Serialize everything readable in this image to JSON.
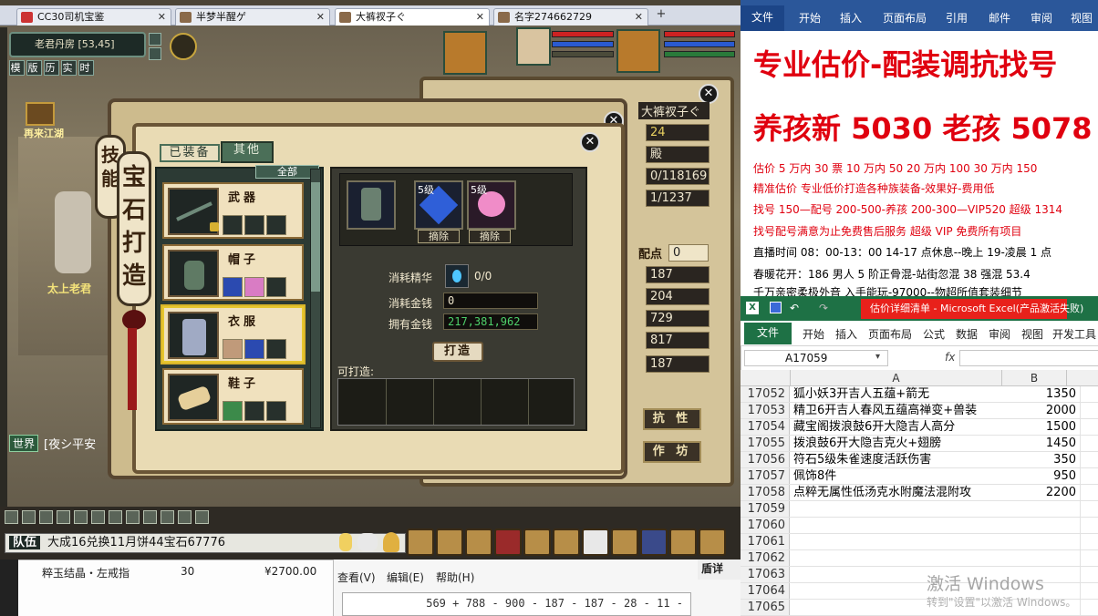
{
  "browser": {
    "tabs": [
      {
        "label": "CC30司机宝鉴"
      },
      {
        "label": "半梦半醒ゲ"
      },
      {
        "label": "大裤衩子ぐ"
      },
      {
        "label": "名字274662729"
      }
    ],
    "new_tab": "+"
  },
  "game": {
    "location": "老君丹房 [53,45]",
    "mini_buttons": [
      "模",
      "版",
      "历",
      "实",
      "时"
    ],
    "npc_labels": [
      "再来江湖",
      "太上老君"
    ],
    "world_channel": "世界",
    "world_text": "[夜シ平安",
    "back_window": {
      "name": "大裤衩子ぐ",
      "level": "24",
      "title": "殿",
      "hp": "0/118169",
      "mp": "1/1237",
      "points_label": "配点",
      "points": "0",
      "stats": [
        "187",
        "204",
        "729",
        "817",
        "187"
      ],
      "buttons": {
        "resist": "抗 性",
        "workshop": "作 坊"
      }
    },
    "gem_dialog": {
      "title_back": "技能",
      "title": "宝石打造",
      "tabs": {
        "equipped": "已装备",
        "other": "其他"
      },
      "filter": "全部",
      "items": [
        {
          "name": "武器"
        },
        {
          "name": "帽子"
        },
        {
          "name": "衣服"
        },
        {
          "name": "鞋子"
        }
      ],
      "gem_level": "5级",
      "remove_label": "摘除",
      "consume_essence_label": "消耗精华",
      "consume_essence_value": "0/0",
      "consume_money_label": "消耗金钱",
      "consume_money_value": "0",
      "owned_money_label": "拥有金钱",
      "owned_money_value": "217,381,962",
      "craft_button": "打造",
      "craftable_label": "可打造:"
    },
    "chat": {
      "channel": "队伍",
      "text": "大成16兑换11月饼44宝石67776"
    }
  },
  "overlays": {
    "listing_name": "粹玉结晶・左戒指",
    "listing_qty": "30",
    "listing_price": "¥2700.00",
    "calc_menu": [
      "查看(V)",
      "编辑(E)",
      "帮助(H)"
    ],
    "calc_expr": "569 + 788 - 900 - 187 - 187 - 28 - 11 -",
    "side_text": "盾详"
  },
  "word": {
    "ribbon_file": "文件",
    "ribbon_tabs": [
      "开始",
      "插入",
      "页面布局",
      "引用",
      "邮件",
      "审阅",
      "视图"
    ],
    "lines": [
      "专业估价-配装调抗找号",
      "养孩新 5030 老孩 5078",
      "估价 5 万内 30 票   10 万内 50   20 万内 100   30 万内 150",
      "精准估价   专业低价打造各种族装备-效果好-费用低",
      "找号 150—配号 200-500-养孩 200-300—VIP520 超级 1314",
      "找号配号满意为止免费售后服务    超级 VIP 免费所有项目",
      "直播时间 08：00-13：00  14-17 点休息--晚上 19-凌晨 1 点",
      "春暖花开：186 男人 5 阶正骨混-站街忽混 38 强混 53.4",
      "千万亲密柔极外音 入手能玩-97000--物超所值套装细节"
    ]
  },
  "excel": {
    "title": "估价详细清单 - Microsoft Excel(产品激活失败)",
    "ribbon_file": "文件",
    "ribbon_tabs": [
      "开始",
      "插入",
      "页面布局",
      "公式",
      "数据",
      "审阅",
      "视图",
      "开发工具"
    ],
    "namebox": "A17059",
    "fx": "fx",
    "columns": [
      "A",
      "B"
    ],
    "rows": [
      {
        "n": "17052",
        "a": "狐小妖3开吉人五蕴+箭无",
        "b": "1350"
      },
      {
        "n": "17053",
        "a": "精卫6开吉人春风五蕴高禅变+兽装",
        "b": "2000"
      },
      {
        "n": "17054",
        "a": "藏宝阁拨浪鼓6开大隐吉人高分",
        "b": "1500"
      },
      {
        "n": "17055",
        "a": "拨浪鼓6开大隐吉克火+翅膀",
        "b": "1450"
      },
      {
        "n": "17056",
        "a": "符石5级朱雀速度活跃伤害",
        "b": "350"
      },
      {
        "n": "17057",
        "a": "佩饰8件",
        "b": "950"
      },
      {
        "n": "17058",
        "a": "点粹无属性低汤克水附魔法混附攻",
        "b": "2200"
      },
      {
        "n": "17059",
        "a": "",
        "b": ""
      },
      {
        "n": "17060",
        "a": "",
        "b": ""
      },
      {
        "n": "17061",
        "a": "",
        "b": ""
      },
      {
        "n": "17062",
        "a": "",
        "b": ""
      },
      {
        "n": "17063",
        "a": "",
        "b": ""
      },
      {
        "n": "17064",
        "a": "",
        "b": ""
      },
      {
        "n": "17065",
        "a": "",
        "b": ""
      }
    ]
  },
  "watermark": {
    "line1": "激活 Windows",
    "line2": "转到\"设置\"以激活 Windows。"
  },
  "colors": {
    "word_red": "#e0000f",
    "excel_green": "#1e7145",
    "word_blue": "#2b579a"
  }
}
